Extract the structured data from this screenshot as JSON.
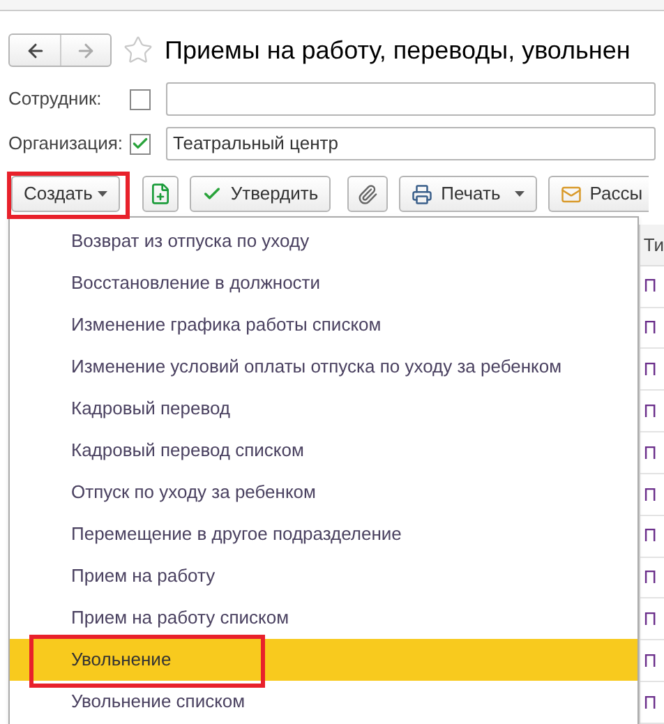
{
  "window": {
    "title": "Приемы на работу, переводы, увольнен"
  },
  "filters": [
    {
      "label": "Сотрудник:",
      "checked": false
    },
    {
      "label": "Организация:",
      "checked": true,
      "value": "Театральный центр"
    }
  ],
  "toolbar": [
    {
      "kind": "dropdown",
      "label": "Создать",
      "annotated": true
    },
    {
      "kind": "add-icon"
    },
    {
      "kind": "check",
      "label": "Утвердить"
    },
    {
      "kind": "clip"
    },
    {
      "kind": "print",
      "label": "Печать"
    },
    {
      "kind": "mail",
      "label": "Рассы"
    }
  ],
  "menu": [
    {
      "label": "Возврат из отпуска по уходу",
      "selected": false,
      "annotated": false
    },
    {
      "label": "Восстановление в должности",
      "selected": false,
      "annotated": false
    },
    {
      "label": "Изменение графика работы списком",
      "selected": false,
      "annotated": false
    },
    {
      "label": "Изменение условий оплаты отпуска по уходу за ребенком",
      "selected": false,
      "annotated": false
    },
    {
      "label": "Кадровый перевод",
      "selected": false,
      "annotated": false
    },
    {
      "label": "Кадровый перевод списком",
      "selected": false,
      "annotated": false
    },
    {
      "label": "Отпуск по уходу за ребенком",
      "selected": false,
      "annotated": false
    },
    {
      "label": "Перемещение в другое подразделение",
      "selected": false,
      "annotated": false
    },
    {
      "label": "Прием на работу",
      "selected": false,
      "annotated": false
    },
    {
      "label": "Прием на работу списком",
      "selected": false,
      "annotated": false
    },
    {
      "label": "Увольнение",
      "selected": true,
      "annotated": true
    },
    {
      "label": "Увольнение списком",
      "selected": false,
      "annotated": false
    }
  ],
  "table": {
    "column_1": "Ти",
    "rows": [
      "П",
      "П",
      "П",
      "П",
      "П",
      "П",
      "П",
      "П",
      "П",
      "П",
      "П"
    ]
  }
}
